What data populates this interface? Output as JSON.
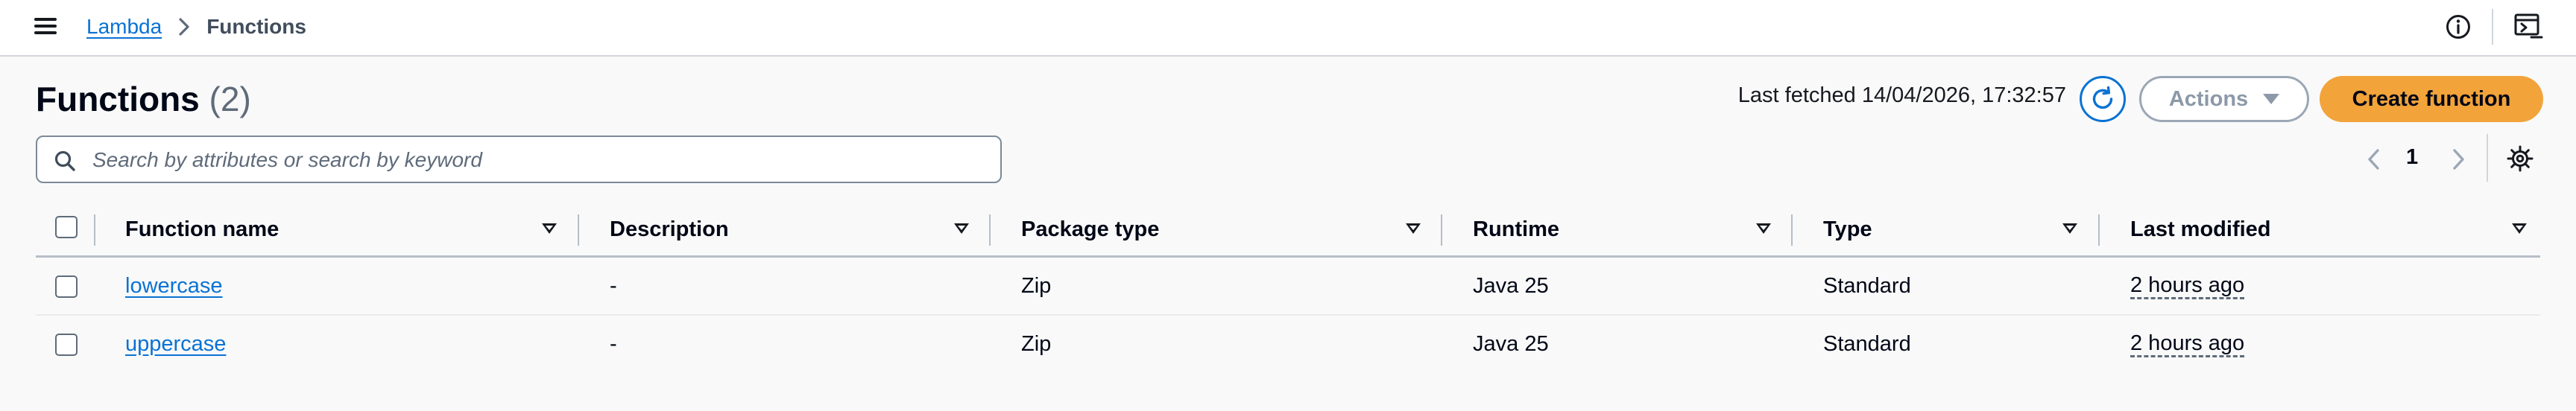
{
  "breadcrumb": {
    "parent": "Lambda",
    "current": "Functions"
  },
  "header": {
    "title": "Functions",
    "count": "(2)",
    "last_fetched": "Last fetched 14/04/2026, 17:32:57",
    "actions_label": "Actions",
    "create_label": "Create function"
  },
  "search": {
    "placeholder": "Search by attributes or search by keyword",
    "value": ""
  },
  "pagination": {
    "current_page": "1"
  },
  "table": {
    "columns": [
      "Function name",
      "Description",
      "Package type",
      "Runtime",
      "Type",
      "Last modified"
    ],
    "rows": [
      {
        "name": "lowercase",
        "description": "-",
        "package_type": "Zip",
        "runtime": "Java 25",
        "type": "Standard",
        "last_modified": "2 hours ago"
      },
      {
        "name": "uppercase",
        "description": "-",
        "package_type": "Zip",
        "runtime": "Java 25",
        "type": "Standard",
        "last_modified": "2 hours ago"
      }
    ]
  },
  "icons": {
    "menu": "menu-icon",
    "breadcrumb_separator": "chevron-right-icon",
    "info": "info-icon",
    "console": "cloudshell-icon",
    "refresh": "refresh-icon",
    "actions_caret": "caret-down-icon",
    "search": "search-icon",
    "prev": "chevron-left-icon",
    "next": "chevron-right-icon",
    "settings": "gear-icon",
    "sort": "sort-icon"
  },
  "colors": {
    "link": "#0972d3",
    "primary_button": "#f2a33a",
    "text": "#000716",
    "background": "#f9f9f9"
  }
}
